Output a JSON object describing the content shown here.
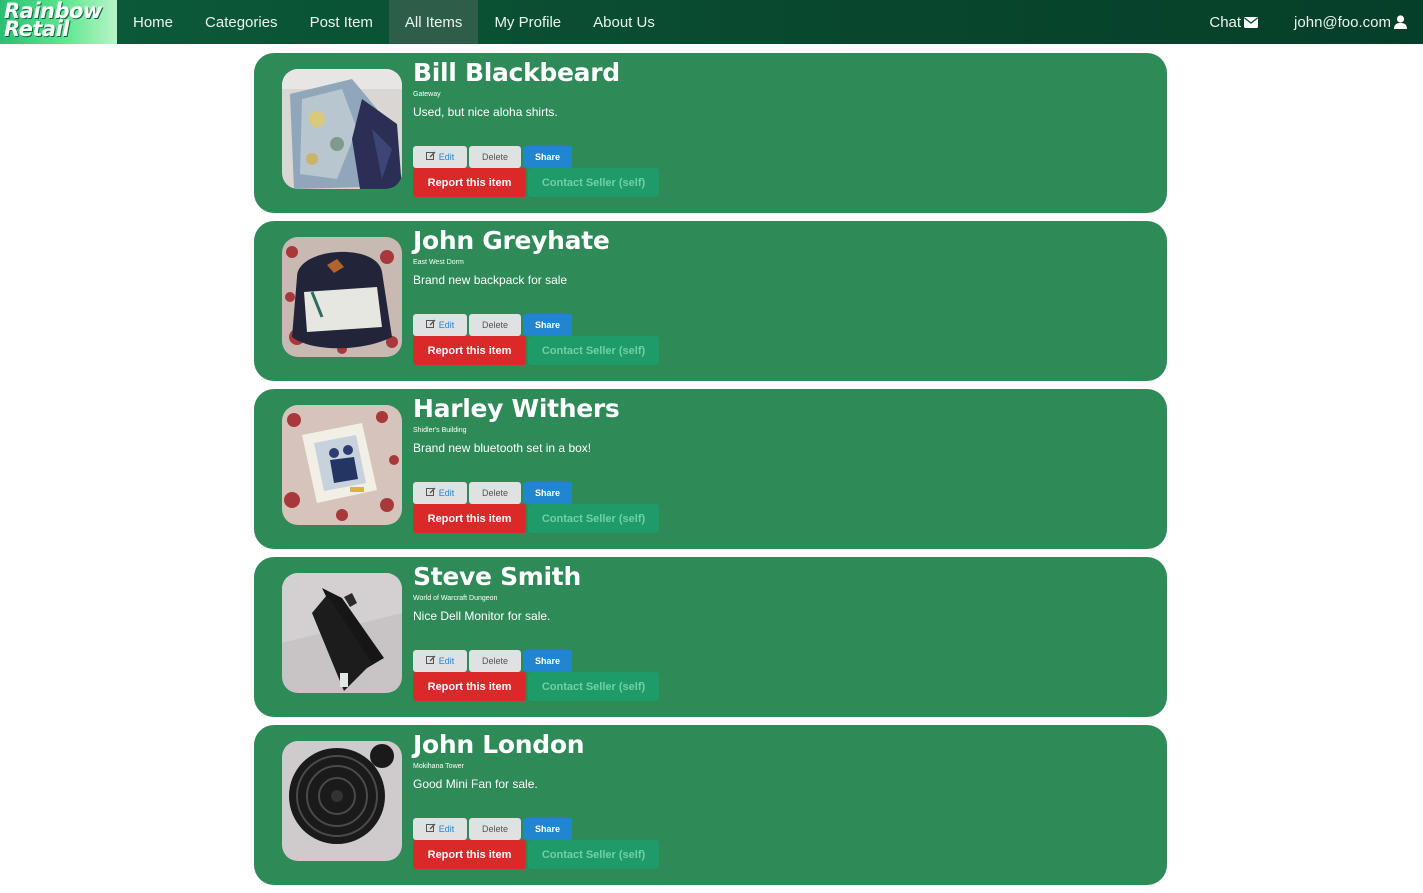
{
  "logo": {
    "line1": "Rainbow",
    "line2": "Retail"
  },
  "nav": {
    "items": [
      {
        "label": "Home"
      },
      {
        "label": "Categories"
      },
      {
        "label": "Post Item"
      },
      {
        "label": "All Items"
      },
      {
        "label": "My Profile"
      },
      {
        "label": "About Us"
      }
    ],
    "active": "All Items",
    "chat_label": "Chat",
    "user_label": "john@foo.com"
  },
  "buttons": {
    "edit": "Edit",
    "delete": "Delete",
    "share": "Share",
    "report": "Report this item",
    "contact": "Contact Seller (self)"
  },
  "items": [
    {
      "name": "Bill Blackbeard",
      "location": "Gateway",
      "description": "Used, but nice aloha shirts.",
      "image": "aloha-shirts-photo"
    },
    {
      "name": "John Greyhate",
      "location": "East West Dorm",
      "description": "Brand new backpack for sale",
      "image": "backpack-photo"
    },
    {
      "name": "Harley Withers",
      "location": "Shidler's Building",
      "description": "Brand new bluetooth set in a box!",
      "image": "bluetooth-box-photo"
    },
    {
      "name": "Steve Smith",
      "location": "World of Warcraft Dungeon",
      "description": "Nice Dell Monitor for sale.",
      "image": "monitor-photo"
    },
    {
      "name": "John London",
      "location": "Mokihana Tower",
      "description": "Good Mini Fan for sale.",
      "image": "fan-photo"
    }
  ],
  "colors": {
    "card": "#2e8a57",
    "navbar": "#08472e",
    "share": "#2185d0",
    "report": "#db2828",
    "contact": "#1f9b6a"
  }
}
